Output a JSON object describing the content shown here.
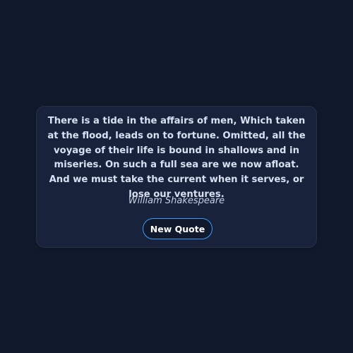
{
  "quote": {
    "text": "There is a tide in the affairs of men, Which taken at the flood, leads on to fortune. Omitted, all the voyage of their life is bound in shallows and in miseries. On such a full sea are we now afloat. And we must take the current when it serves, or lose our ventures.",
    "author": "William Shakespeare"
  },
  "actions": {
    "new_quote_label": "New Quote"
  },
  "colors": {
    "background": "#111a2c",
    "card": "#18223a",
    "accent": "#3a9cff",
    "text": "#d7e1f2"
  }
}
